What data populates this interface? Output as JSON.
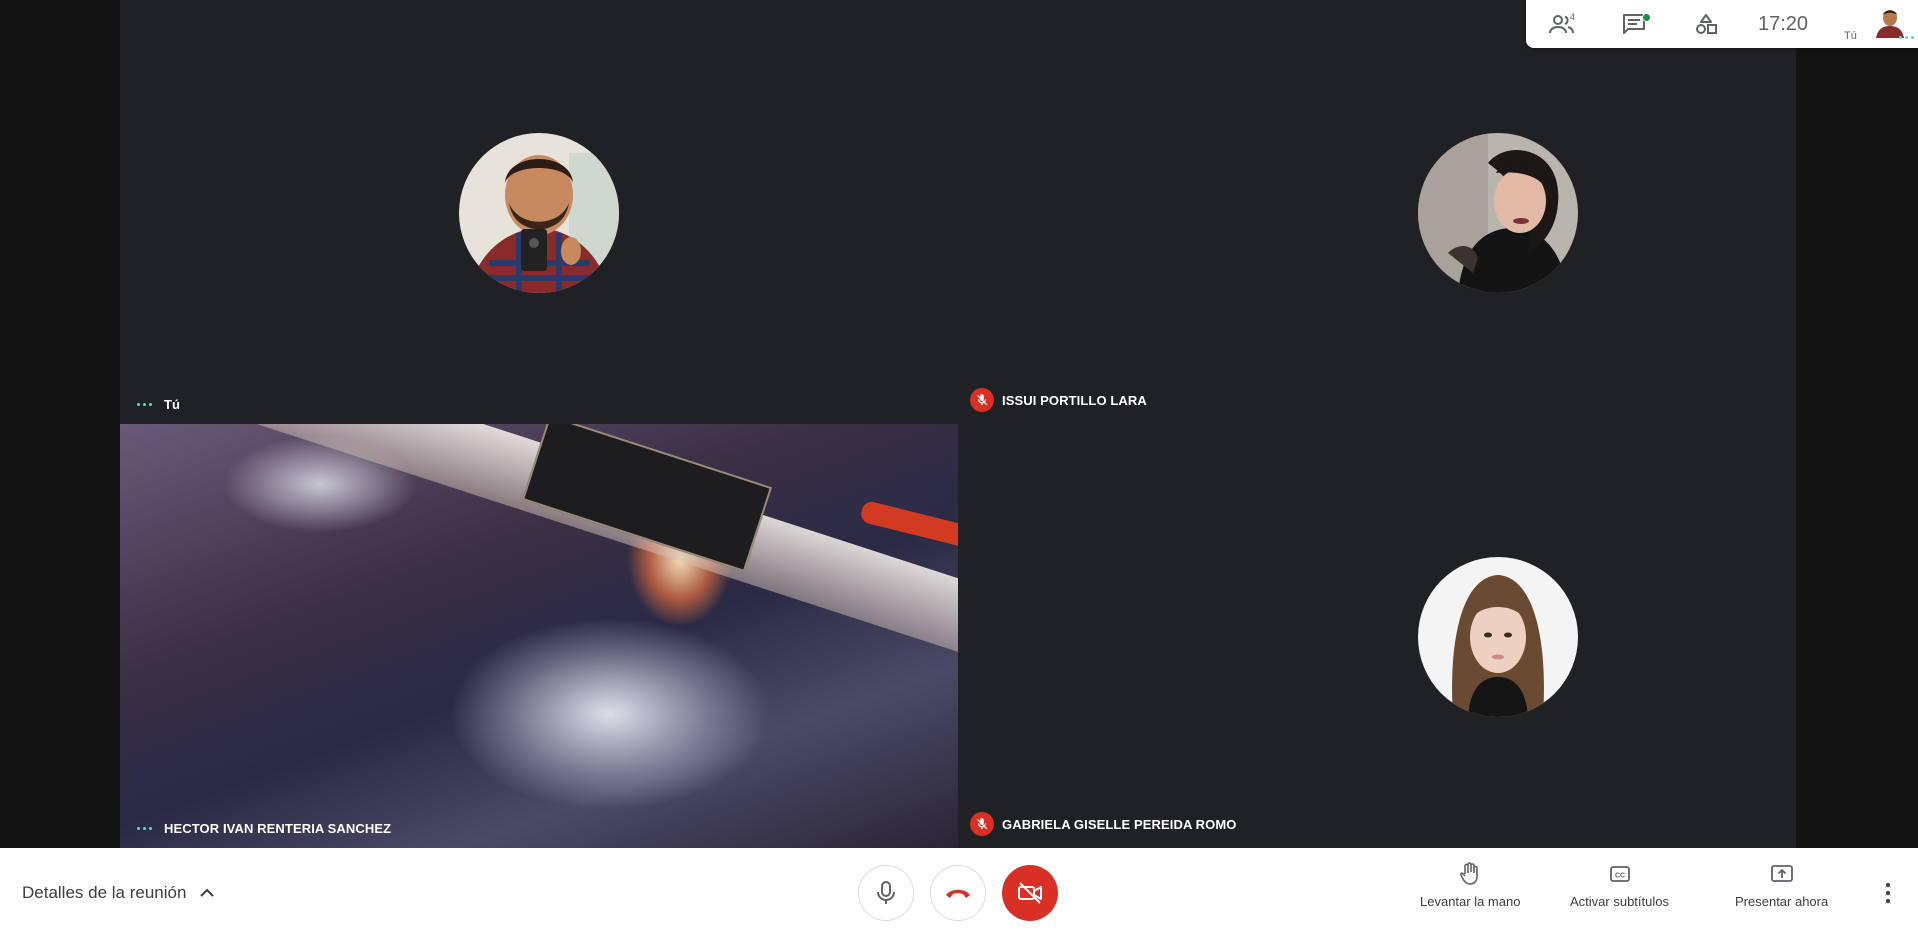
{
  "participants": [
    {
      "name": "Tú",
      "status": "speaking"
    },
    {
      "name": "ISSUI PORTILLO LARA",
      "status": "muted"
    },
    {
      "name": "HECTOR IVAN RENTERIA SANCHEZ",
      "status": "speaking"
    },
    {
      "name": "GABRIELA GISELLE PEREIDA ROMO",
      "status": "muted"
    }
  ],
  "topbar": {
    "people_count": "4",
    "time": "17:20",
    "self_label": "Tú",
    "icons": [
      "people-icon",
      "chat-icon",
      "activities-icon"
    ]
  },
  "bottombar": {
    "details_label": "Detalles de la reunión",
    "raise_hand_label": "Levantar la mano",
    "captions_label": "Activar subtítulos",
    "present_label": "Presentar ahora"
  },
  "colors": {
    "accent_red": "#d93025",
    "tile_bg": "#202124",
    "speaking_dots": "#62d3d0",
    "text_gray": "#3c4043"
  }
}
